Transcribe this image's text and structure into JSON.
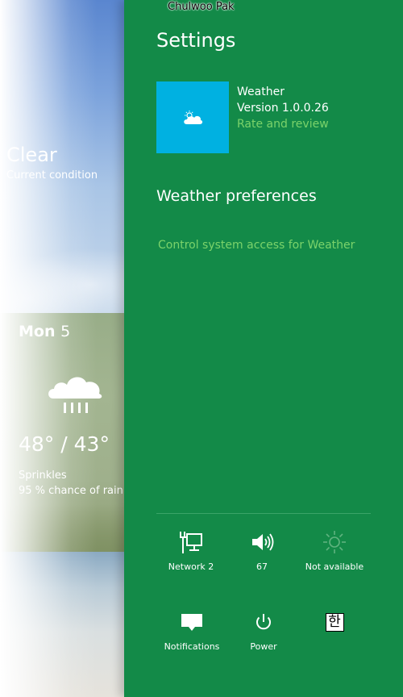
{
  "user": {
    "name": "Chulwoo Pak"
  },
  "weather_app": {
    "current": {
      "condition": "Clear",
      "caption": "Current condition"
    },
    "forecast": {
      "day_name": "Mon",
      "day_number": "5",
      "temps": "48° / 43°",
      "description": "Sprinkles",
      "rain_chance": "95 % chance of rain",
      "icon": "rain-cloud-icon"
    }
  },
  "settings": {
    "title": "Settings",
    "app": {
      "name": "Weather",
      "version": "Version 1.0.0.26",
      "rate_link": "Rate and review",
      "tile_color": "#00b1e1",
      "tile_icon": "cloud-sun-icon"
    },
    "preferences_heading": "Weather preferences",
    "control_access_link": "Control system access for Weather",
    "pane_color": "#138a48",
    "link_color": "#7bd36a"
  },
  "quick_settings": {
    "network": {
      "label": "Network  2",
      "icon": "network-icon"
    },
    "volume": {
      "label": "67",
      "icon": "speaker-icon"
    },
    "brightness": {
      "label": "Not available",
      "icon": "brightness-icon"
    },
    "notifications": {
      "label": "Notifications",
      "icon": "notifications-icon"
    },
    "power": {
      "label": "Power",
      "icon": "power-icon"
    },
    "keyboard": {
      "label": "한",
      "icon": "keyboard-ime-icon"
    }
  }
}
